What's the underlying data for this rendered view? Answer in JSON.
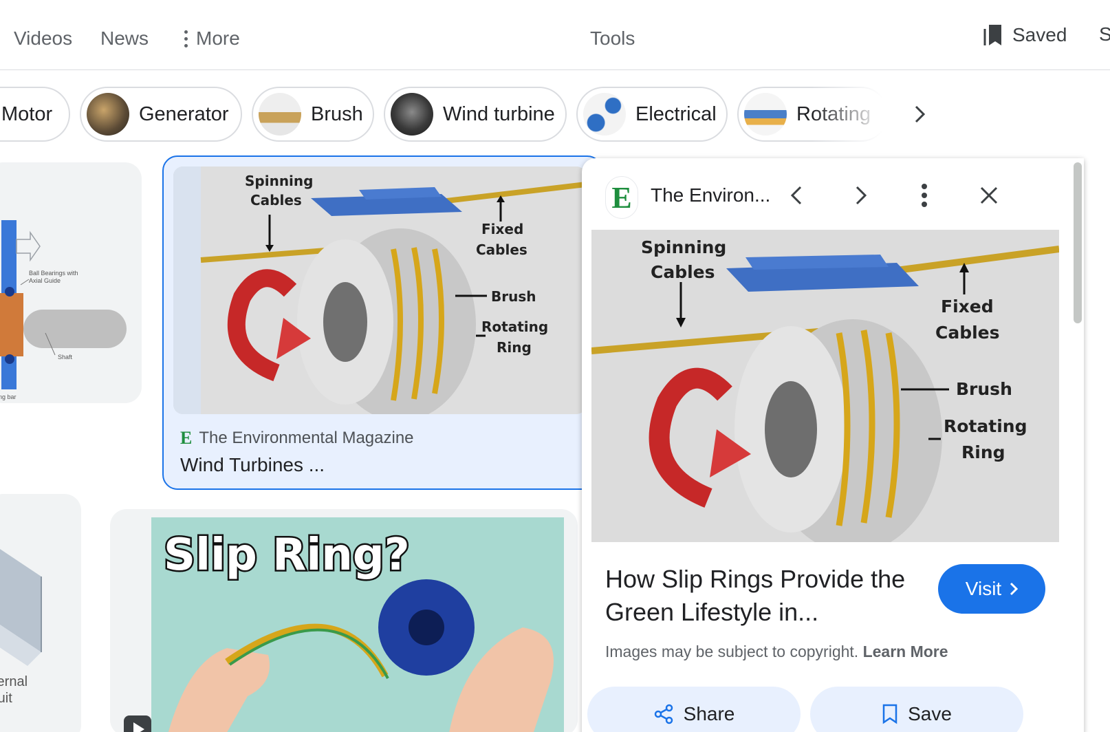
{
  "nav": {
    "tabs": [
      "Videos",
      "News",
      "More",
      "Tools"
    ],
    "saved_label": "Saved",
    "cut_label": "S"
  },
  "chips": [
    "Motor",
    "Generator",
    "Brush",
    "Wind turbine",
    "Electrical",
    "Rotating"
  ],
  "results": {
    "selected": {
      "source": "The Environmental Magazine",
      "title": "Wind Turbines ...",
      "logo_letter": "E"
    },
    "video": {
      "image_text": "Slip Ring?"
    },
    "left_diagram_labels": [
      "Ball Bearings with Axial Guide",
      "Shaft",
      "ing bar"
    ],
    "left_bottom_labels": [
      "xternal",
      "rcuit"
    ]
  },
  "diagram": {
    "spinning": "Spinning",
    "cables": "Cables",
    "fixed": "Fixed",
    "fixed_cables": "Cables",
    "brush": "Brush",
    "rotating": "Rotating",
    "ring": "Ring"
  },
  "panel": {
    "source": "The Environ...",
    "logo_letter": "E",
    "title": "How Slip Rings Provide the Green Lifestyle in...",
    "visit_label": "Visit",
    "copyright_text": "Images may be subject to copyright.",
    "learn_more": "Learn More",
    "share_label": "Share",
    "save_label": "Save"
  },
  "colors": {
    "accent": "#1a73e8",
    "selected_bg": "#e8f0fe",
    "logo_green": "#1e8e3e"
  }
}
